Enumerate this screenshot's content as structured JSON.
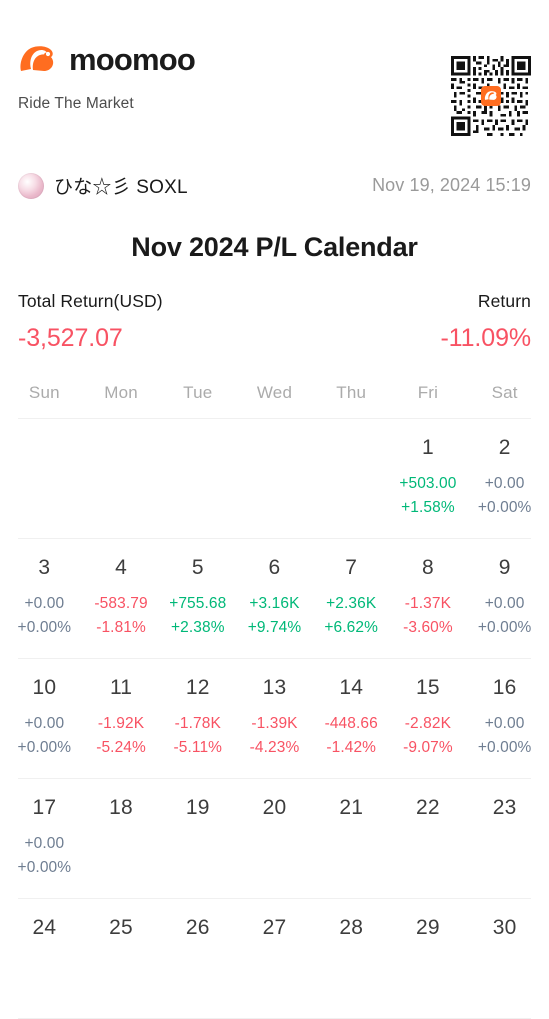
{
  "brand": {
    "logo_icon": "moomoo-bull-logo",
    "name": "moomoo",
    "tagline": "Ride The Market",
    "qr_icon": "qr-code"
  },
  "user": {
    "avatar_icon": "user-avatar",
    "name": "ひな☆彡 SOXL",
    "timestamp": "Nov 19, 2024 15:19"
  },
  "title": "Nov 2024 P/L Calendar",
  "summary": {
    "total_return_label": "Total Return(USD)",
    "total_return_value": "-3,527.07",
    "return_label": "Return",
    "return_value": "-11.09%"
  },
  "colors": {
    "positive": "#00b878",
    "negative": "#f85263",
    "zero": "#6e7d91",
    "brand": "#FF6D20",
    "day_number": "#3d3d3d",
    "weekday_header": "#ababab"
  },
  "calendar": {
    "weekdays": [
      "Sun",
      "Mon",
      "Tue",
      "Wed",
      "Thu",
      "Fri",
      "Sat"
    ],
    "weeks": [
      [
        {
          "day": "",
          "amount": "",
          "percent": "",
          "tone": ""
        },
        {
          "day": "",
          "amount": "",
          "percent": "",
          "tone": ""
        },
        {
          "day": "",
          "amount": "",
          "percent": "",
          "tone": ""
        },
        {
          "day": "",
          "amount": "",
          "percent": "",
          "tone": ""
        },
        {
          "day": "",
          "amount": "",
          "percent": "",
          "tone": ""
        },
        {
          "day": "1",
          "amount": "+503.00",
          "percent": "+1.58%",
          "tone": "pos"
        },
        {
          "day": "2",
          "amount": "+0.00",
          "percent": "+0.00%",
          "tone": "zero"
        }
      ],
      [
        {
          "day": "3",
          "amount": "+0.00",
          "percent": "+0.00%",
          "tone": "zero"
        },
        {
          "day": "4",
          "amount": "-583.79",
          "percent": "-1.81%",
          "tone": "neg"
        },
        {
          "day": "5",
          "amount": "+755.68",
          "percent": "+2.38%",
          "tone": "pos"
        },
        {
          "day": "6",
          "amount": "+3.16K",
          "percent": "+9.74%",
          "tone": "pos"
        },
        {
          "day": "7",
          "amount": "+2.36K",
          "percent": "+6.62%",
          "tone": "pos"
        },
        {
          "day": "8",
          "amount": "-1.37K",
          "percent": "-3.60%",
          "tone": "neg"
        },
        {
          "day": "9",
          "amount": "+0.00",
          "percent": "+0.00%",
          "tone": "zero"
        }
      ],
      [
        {
          "day": "10",
          "amount": "+0.00",
          "percent": "+0.00%",
          "tone": "zero"
        },
        {
          "day": "11",
          "amount": "-1.92K",
          "percent": "-5.24%",
          "tone": "neg"
        },
        {
          "day": "12",
          "amount": "-1.78K",
          "percent": "-5.11%",
          "tone": "neg"
        },
        {
          "day": "13",
          "amount": "-1.39K",
          "percent": "-4.23%",
          "tone": "neg"
        },
        {
          "day": "14",
          "amount": "-448.66",
          "percent": "-1.42%",
          "tone": "neg"
        },
        {
          "day": "15",
          "amount": "-2.82K",
          "percent": "-9.07%",
          "tone": "neg"
        },
        {
          "day": "16",
          "amount": "+0.00",
          "percent": "+0.00%",
          "tone": "zero"
        }
      ],
      [
        {
          "day": "17",
          "amount": "+0.00",
          "percent": "+0.00%",
          "tone": "zero"
        },
        {
          "day": "18",
          "amount": "",
          "percent": "",
          "tone": ""
        },
        {
          "day": "19",
          "amount": "",
          "percent": "",
          "tone": ""
        },
        {
          "day": "20",
          "amount": "",
          "percent": "",
          "tone": ""
        },
        {
          "day": "21",
          "amount": "",
          "percent": "",
          "tone": ""
        },
        {
          "day": "22",
          "amount": "",
          "percent": "",
          "tone": ""
        },
        {
          "day": "23",
          "amount": "",
          "percent": "",
          "tone": ""
        }
      ],
      [
        {
          "day": "24",
          "amount": "",
          "percent": "",
          "tone": ""
        },
        {
          "day": "25",
          "amount": "",
          "percent": "",
          "tone": ""
        },
        {
          "day": "26",
          "amount": "",
          "percent": "",
          "tone": ""
        },
        {
          "day": "27",
          "amount": "",
          "percent": "",
          "tone": ""
        },
        {
          "day": "28",
          "amount": "",
          "percent": "",
          "tone": ""
        },
        {
          "day": "29",
          "amount": "",
          "percent": "",
          "tone": ""
        },
        {
          "day": "30",
          "amount": "",
          "percent": "",
          "tone": ""
        }
      ]
    ]
  }
}
